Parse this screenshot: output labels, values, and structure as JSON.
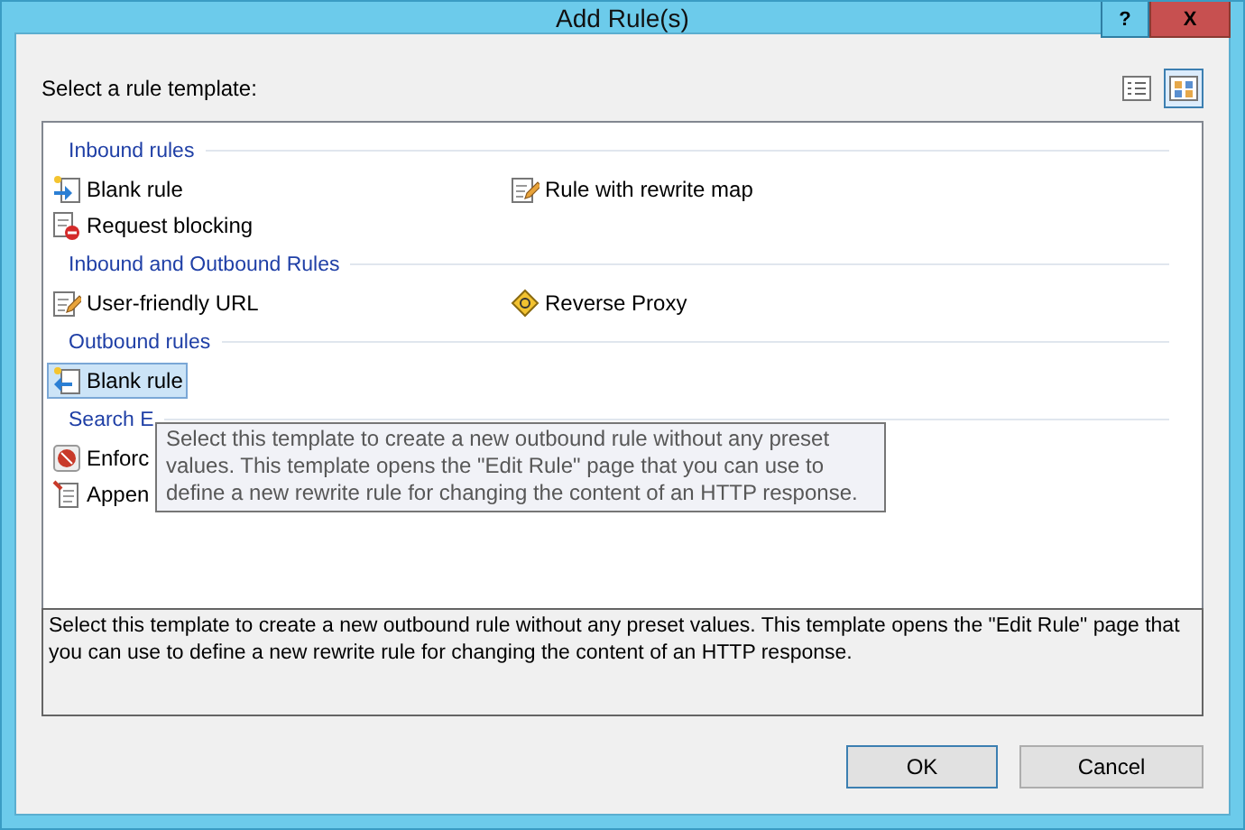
{
  "window": {
    "title": "Add Rule(s)",
    "help": "?",
    "close": "X"
  },
  "prompt": "Select a rule template:",
  "views": [
    {
      "kind": "details",
      "selected": false
    },
    {
      "kind": "tiles",
      "selected": true
    }
  ],
  "sections": [
    {
      "title": "Inbound rules",
      "items": [
        {
          "label": "Blank rule",
          "kind": "blank-in",
          "selected": false
        },
        {
          "label": "Rule with rewrite map",
          "kind": "edit",
          "selected": false
        },
        {
          "label": "Request blocking",
          "kind": "block",
          "selected": false
        }
      ]
    },
    {
      "title": "Inbound and Outbound Rules",
      "items": [
        {
          "label": "User-friendly URL",
          "kind": "edit",
          "selected": false
        },
        {
          "label": "Reverse Proxy",
          "kind": "proxy",
          "selected": false
        }
      ]
    },
    {
      "title": "Outbound rules",
      "items": [
        {
          "label": "Blank rule",
          "kind": "blank-out",
          "selected": true
        }
      ]
    },
    {
      "title": "Search E",
      "items": [
        {
          "label": "Enforc",
          "kind": "seo",
          "selected": false
        },
        {
          "label": "Appen",
          "kind": "pin",
          "selected": false
        }
      ]
    }
  ],
  "tooltip": "Select this template to create a new outbound rule without any preset values. This template opens the \"Edit Rule\" page that you can use to define a new rewrite rule for changing the content of an HTTP response.",
  "description": "Select this template to create a new outbound rule without any preset values. This template opens the \"Edit Rule\" page that you can use to define a new rewrite rule for changing the content of an HTTP response.",
  "buttons": [
    {
      "label": "OK",
      "default": true
    },
    {
      "label": "Cancel",
      "default": false
    }
  ]
}
